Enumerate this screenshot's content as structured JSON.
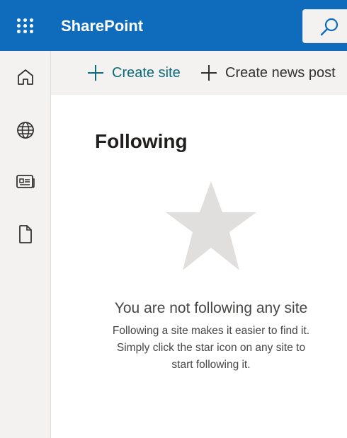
{
  "app": {
    "title": "SharePoint",
    "accent_color": "#0f6cbd",
    "waffle_icon": "app-launcher-icon",
    "search_icon": "search-icon"
  },
  "left_nav": {
    "items": [
      {
        "icon": "home-icon"
      },
      {
        "icon": "globe-icon"
      },
      {
        "icon": "news-icon"
      },
      {
        "icon": "document-icon"
      }
    ]
  },
  "command_bar": {
    "create_site_label": "Create site",
    "create_news_label": "Create news post"
  },
  "main": {
    "title": "Following",
    "empty_state": {
      "icon": "star-icon",
      "heading": "You are not following any site",
      "line1": "Following a site makes it easier to find it.",
      "line2": "Simply click the star icon on any site to",
      "line3": "start following it."
    }
  }
}
